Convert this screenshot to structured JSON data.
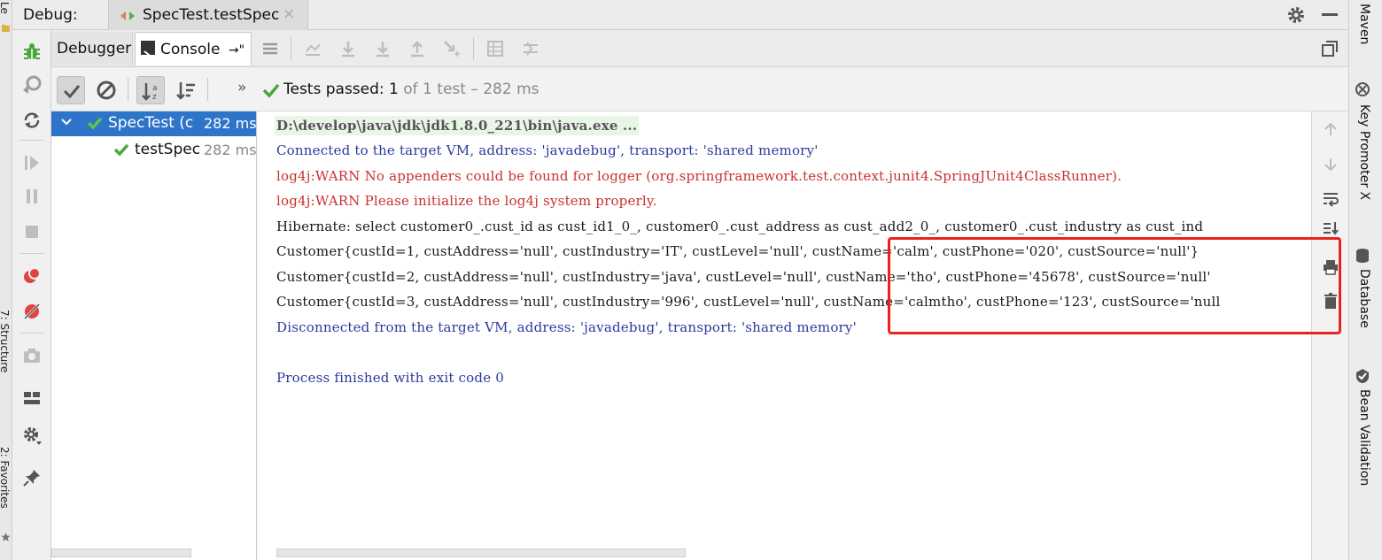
{
  "left_stripe": {
    "top_label": "Le",
    "structure_label": "7: Structure",
    "favorites_label": "2: Favorites"
  },
  "right_stripe": {
    "tabs": [
      "Maven",
      "Key Promoter X",
      "Database",
      "Bean Validation"
    ]
  },
  "debug_header": {
    "label": "Debug:",
    "tab_title": "SpecTest.testSpec",
    "close_glyph": "×"
  },
  "tabs": {
    "debugger": "Debugger",
    "console": "Console",
    "console_suffix": "→\""
  },
  "test_toolbar": {
    "overflow": "»",
    "status_main": "Tests passed: 1",
    "status_rest": "of 1 test – 282 ms"
  },
  "tree": {
    "root": {
      "label": "SpecTest (c",
      "duration": "282 ms"
    },
    "child": {
      "label": "testSpec",
      "duration": "282 ms"
    }
  },
  "console": {
    "lines": [
      {
        "text": "D:\\develop\\java\\jdk\\jdk1.8.0_221\\bin\\java.exe ...",
        "kind": "cmd"
      },
      {
        "text": "Connected to the target VM, address: 'javadebug', transport: 'shared memory'",
        "kind": "blue"
      },
      {
        "text": "log4j:WARN No appenders could be found for logger (org.springframework.test.context.junit4.SpringJUnit4ClassRunner).",
        "kind": "red"
      },
      {
        "text": "log4j:WARN Please initialize the log4j system properly.",
        "kind": "red"
      },
      {
        "text": "Hibernate: select customer0_.cust_id as cust_id1_0_, customer0_.cust_address as cust_add2_0_, customer0_.cust_industry as cust_ind",
        "kind": "black"
      },
      {
        "text": "Customer{custId=1, custAddress='null', custIndustry='IT', custLevel='null', custName='calm', custPhone='020', custSource='null'}",
        "kind": "black"
      },
      {
        "text": "Customer{custId=2, custAddress='null', custIndustry='java', custLevel='null', custName='tho', custPhone='45678', custSource='null'",
        "kind": "black"
      },
      {
        "text": "Customer{custId=3, custAddress='null', custIndustry='996', custLevel='null', custName='calmtho', custPhone='123', custSource='null",
        "kind": "black"
      },
      {
        "text": "Disconnected from the target VM, address: 'javadebug', transport: 'shared memory'",
        "kind": "blue"
      },
      {
        "text": "",
        "kind": "black"
      },
      {
        "text": "Process finished with exit code 0",
        "kind": "blue"
      }
    ]
  },
  "colors": {
    "selection": "#2e75c9",
    "pass_green": "#4aa73c",
    "highlight_red": "#e8231f",
    "console_blue": "#2b3a9e",
    "console_red": "#c8322e"
  }
}
